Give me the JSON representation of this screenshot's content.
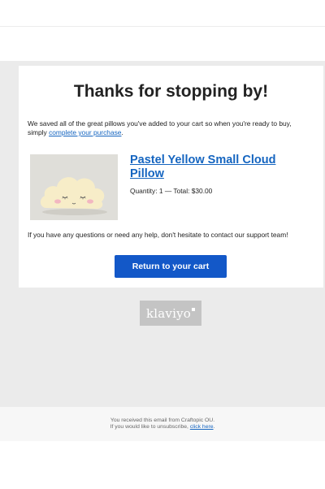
{
  "email": {
    "heading": "Thanks for stopping by!",
    "intro_text": "We saved all of the great pillows you've added to your cart so when you're ready to buy, simply ",
    "intro_link": "complete your purchase",
    "intro_end": ".",
    "product": {
      "title": "Pastel Yellow Small Cloud Pillow",
      "meta": "Quantity: 1 — Total: $30.00",
      "image_icon": "cloud-pillow-image"
    },
    "help_text": "If you have any questions or need any help, don't hesitate to contact our support team!",
    "cta_label": "Return to your cart"
  },
  "branding": {
    "logo_text": "klaviyo",
    "logo_icon": "klaviyo-logo"
  },
  "footer": {
    "line1": "You received this email from Craftopic OU.",
    "line2_text": "If you would like to unsubscribe, ",
    "line2_link": "click here",
    "line2_end": "."
  },
  "colors": {
    "accent": "#1358c8",
    "link": "#1565c0",
    "background": "#ebebeb"
  }
}
